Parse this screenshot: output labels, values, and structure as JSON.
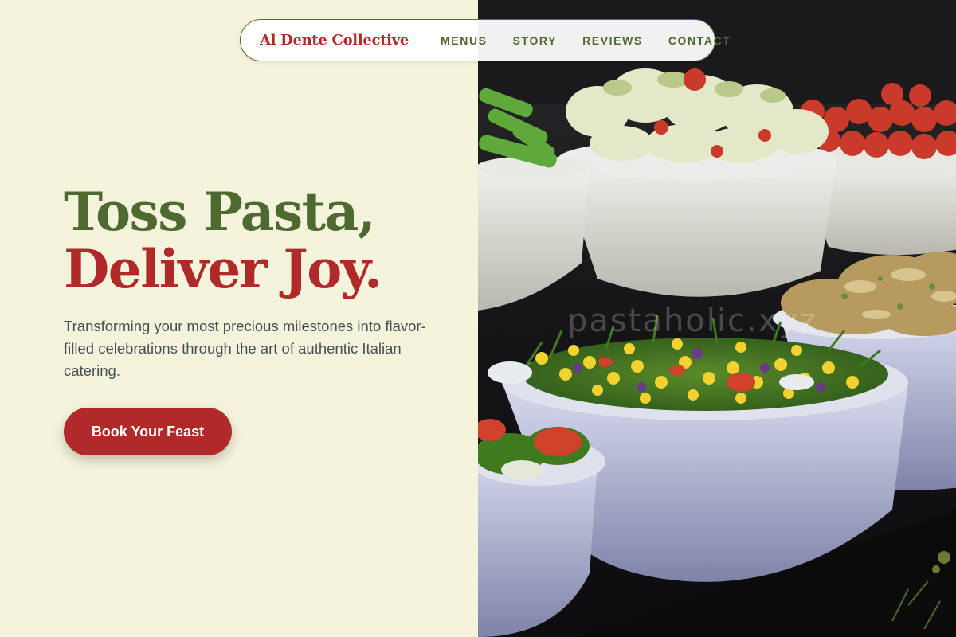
{
  "nav": {
    "brand": "Al Dente Collective",
    "links": [
      "MENUS",
      "STORY",
      "REVIEWS",
      "CONTACT"
    ]
  },
  "hero": {
    "title_line1": "Toss Pasta,",
    "title_line2": "Deliver Joy.",
    "description": "Transforming your most precious milestones into flavor-filled celebrations through the art of authentic Italian catering.",
    "cta_label": "Book Your Feast"
  },
  "image": {
    "watermark": "pastaholic.xyz"
  },
  "colors": {
    "background": "#f4f4dc",
    "brand_red": "#b02a2a",
    "olive_green": "#4f6a30",
    "body_text": "#4a4f55"
  }
}
